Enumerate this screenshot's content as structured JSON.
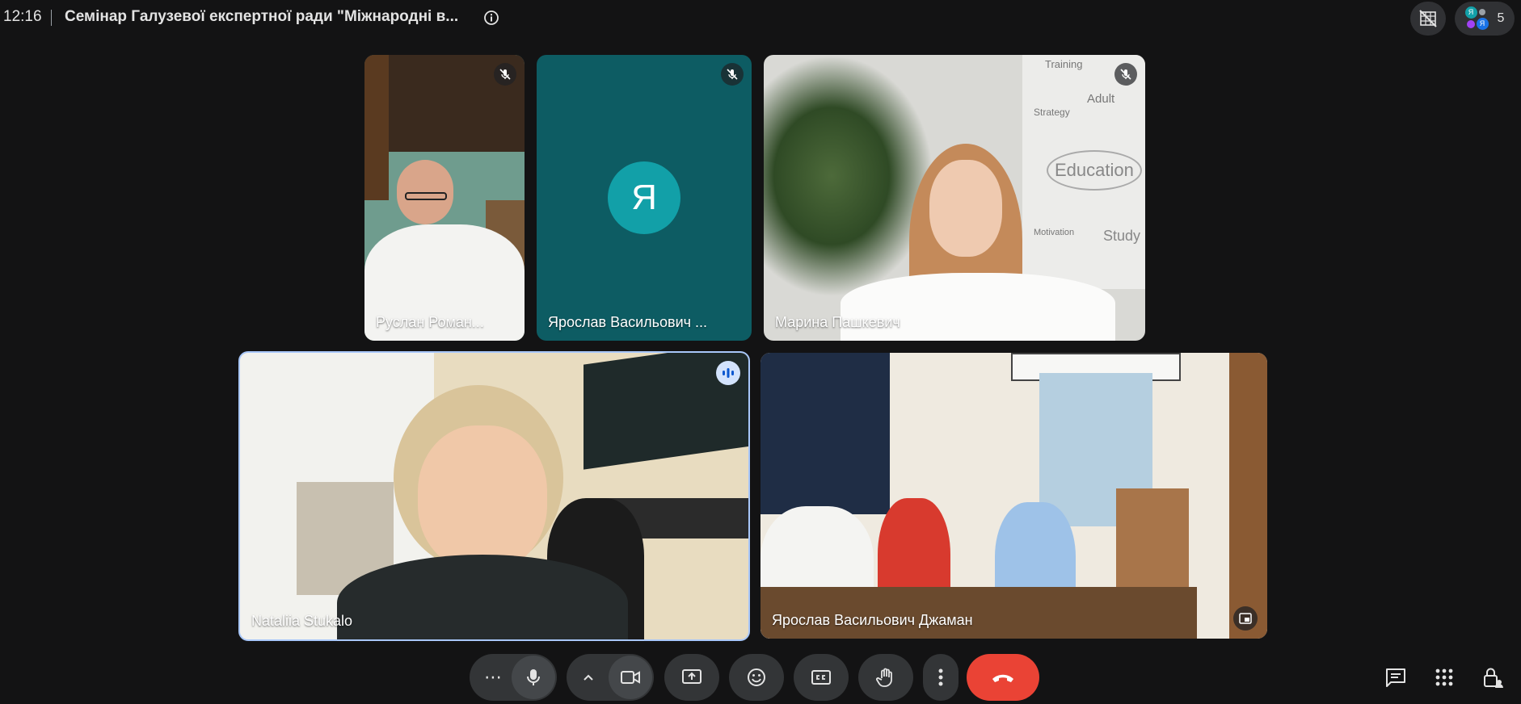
{
  "header": {
    "time": "12:16",
    "title": "Семінар Галузевої експертної ради \"Міжнародні в...",
    "participant_count": "5",
    "participant_avatar_letters": [
      "Я",
      "Я"
    ]
  },
  "tiles": [
    {
      "name": "Руслан Роман...",
      "muted": true
    },
    {
      "name": "Ярослав Васильович ...",
      "avatar_letter": "Я",
      "muted": true
    },
    {
      "name": "Марина Пашкевич",
      "muted": true
    },
    {
      "name": "Nataliia Stukalo",
      "speaking": true
    },
    {
      "name": "Ярослав Васильович Джаман"
    }
  ],
  "background_text": {
    "mindmap": [
      "Training",
      "Adult",
      "Strategy",
      "Education",
      "Motivation",
      "Study"
    ]
  },
  "controls": {
    "more_options": "⋯"
  },
  "colors": {
    "background": "#131314",
    "control_bg": "#333537",
    "hangup": "#ea4335",
    "avatar": "#12a0a8",
    "speaking_border": "#a8c7fa"
  }
}
